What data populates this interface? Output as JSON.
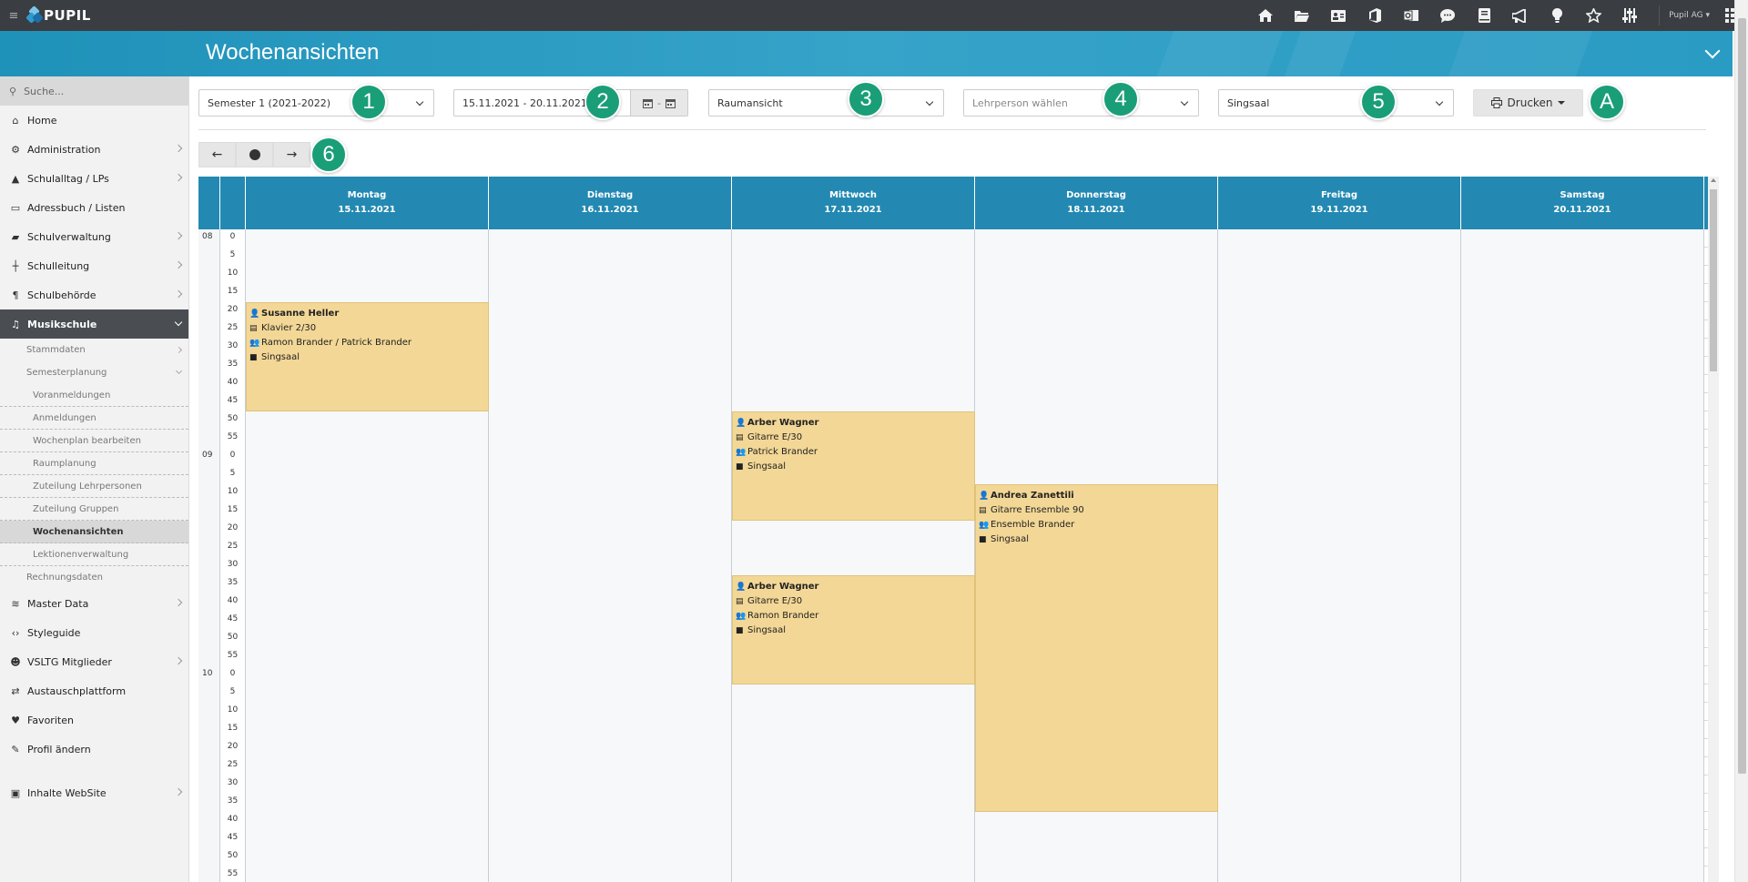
{
  "topbar": {
    "brand": "PUPIL",
    "user": "Pupil AG",
    "icons": [
      "home-icon",
      "folder-icon",
      "contact-card-icon",
      "office-icon",
      "outlook-icon",
      "chat-icon",
      "book-icon",
      "megaphone-icon",
      "lightbulb-icon",
      "star-icon",
      "sliders-icon"
    ]
  },
  "header": {
    "title": "Wochenansichten"
  },
  "sidebar": {
    "search_placeholder": "Suche...",
    "items": [
      {
        "label": "Home"
      },
      {
        "label": "Administration"
      },
      {
        "label": "Schulalltag / LPs"
      },
      {
        "label": "Adressbuch / Listen"
      },
      {
        "label": "Schulverwaltung"
      },
      {
        "label": "Schulleitung"
      },
      {
        "label": "Schulbehörde"
      },
      {
        "label": "Musikschule"
      }
    ],
    "musik_sub": {
      "stammdaten": "Stammdaten",
      "semesterplanung": "Semesterplanung",
      "sem_items": [
        "Voranmeldungen",
        "Anmeldungen",
        "Wochenplan bearbeiten",
        "Raumplanung",
        "Zuteilung Lehrpersonen",
        "Zuteilung Gruppen",
        "Wochenansichten",
        "Lektionenverwaltung"
      ],
      "rechnungsdaten": "Rechnungsdaten"
    },
    "items2": [
      {
        "label": "Master Data"
      },
      {
        "label": "Styleguide"
      },
      {
        "label": "VSLTG Mitglieder"
      },
      {
        "label": "Austauschplattform"
      },
      {
        "label": "Favoriten"
      },
      {
        "label": "Profil ändern"
      }
    ],
    "last": "Inhalte WebSite"
  },
  "toolbar": {
    "semester": "Semester 1 (2021-2022)",
    "daterange": "15.11.2021 - 20.11.2021",
    "view": "Raumansicht",
    "teacher_placeholder": "Lehrperson wählen",
    "room": "Singsaal",
    "print": "Drucken",
    "badges": {
      "b1": "1",
      "b2": "2",
      "b3": "3",
      "b4": "4",
      "b5": "5",
      "b6": "6",
      "bA": "A"
    }
  },
  "calendar": {
    "days": [
      {
        "name": "Montag",
        "date": "15.11.2021"
      },
      {
        "name": "Dienstag",
        "date": "16.11.2021"
      },
      {
        "name": "Mittwoch",
        "date": "17.11.2021"
      },
      {
        "name": "Donnerstag",
        "date": "18.11.2021"
      },
      {
        "name": "Freitag",
        "date": "19.11.2021"
      },
      {
        "name": "Samstag",
        "date": "20.11.2021"
      }
    ],
    "hours": [
      "08",
      "09",
      "10"
    ],
    "minutes": [
      "0",
      "5",
      "10",
      "15",
      "20",
      "25",
      "30",
      "35",
      "40",
      "45",
      "50",
      "55"
    ],
    "events": [
      {
        "day": 0,
        "start": 4,
        "end": 10,
        "teacher": "Susanne Heller",
        "course": "Klavier 2/30",
        "students": "Ramon Brander / Patrick Brander",
        "room": "Singsaal"
      },
      {
        "day": 2,
        "start": 10,
        "end": 16,
        "teacher": "Arber Wagner",
        "course": "Gitarre E/30",
        "students": "Patrick Brander",
        "room": "Singsaal"
      },
      {
        "day": 3,
        "start": 14,
        "end": 32,
        "teacher": "Andrea Zanettili",
        "course": "Gitarre Ensemble 90",
        "students": "Ensemble Brander",
        "room": "Singsaal"
      },
      {
        "day": 2,
        "start": 19,
        "end": 25,
        "teacher": "Arber Wagner",
        "course": "Gitarre E/30",
        "students": "Ramon Brander",
        "room": "Singsaal"
      }
    ]
  }
}
